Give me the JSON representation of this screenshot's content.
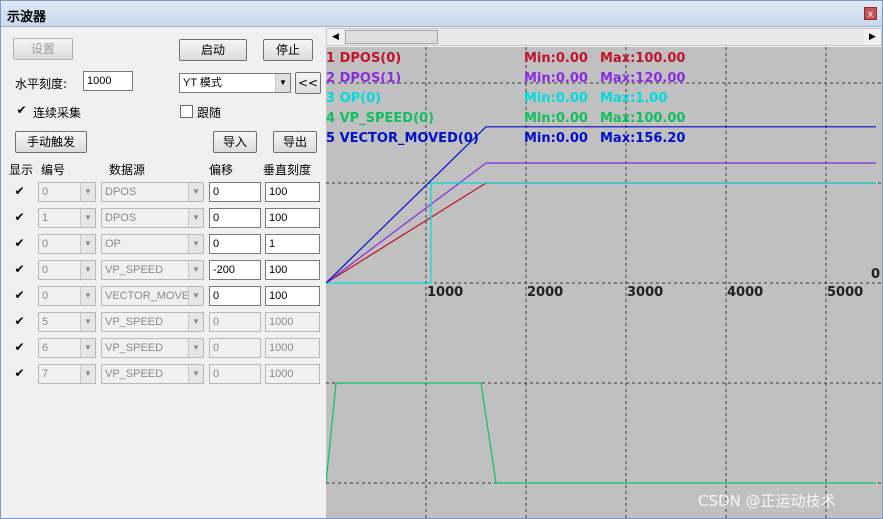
{
  "window": {
    "title": "示波器",
    "close": "x"
  },
  "buttons": {
    "settings": "设置",
    "start": "启动",
    "stop": "停止",
    "collapse": "<<",
    "manual_trigger": "手动触发",
    "import": "导入",
    "export": "导出"
  },
  "labels": {
    "horizontal_scale": "水平刻度:",
    "continuous": "连续采集",
    "follow": "跟随"
  },
  "horizontal_scale_value": "1000",
  "mode": "YT 模式",
  "table": {
    "headers": {
      "show": "显示",
      "num": "编号",
      "source": "数据源",
      "offset": "偏移",
      "vscale": "垂直刻度"
    },
    "rows": [
      {
        "show": "✔",
        "num": "0",
        "source": "DPOS",
        "offset": "0",
        "scale": "100",
        "active": true
      },
      {
        "show": "✔",
        "num": "1",
        "source": "DPOS",
        "offset": "0",
        "scale": "100",
        "active": true
      },
      {
        "show": "✔",
        "num": "0",
        "source": "OP",
        "offset": "0",
        "scale": "1",
        "active": true
      },
      {
        "show": "✔",
        "num": "0",
        "source": "VP_SPEED",
        "offset": "-200",
        "scale": "100",
        "active": true
      },
      {
        "show": "✔",
        "num": "0",
        "source": "VECTOR_MOVED",
        "offset": "0",
        "scale": "100",
        "active": true
      },
      {
        "show": "✔",
        "num": "5",
        "source": "VP_SPEED",
        "offset": "0",
        "scale": "1000",
        "active": false
      },
      {
        "show": "✔",
        "num": "6",
        "source": "VP_SPEED",
        "offset": "0",
        "scale": "1000",
        "active": false
      },
      {
        "show": "✔",
        "num": "7",
        "source": "VP_SPEED",
        "offset": "0",
        "scale": "1000",
        "active": false
      }
    ]
  },
  "scroll": {
    "left": "◀",
    "right": "▶"
  },
  "chart_data": {
    "type": "line",
    "xlim": [
      0,
      5500
    ],
    "x_ticks": [
      "0",
      "1000",
      "2000",
      "3000",
      "4000",
      "5000"
    ],
    "grid": true,
    "legend_position": "top-left",
    "legend": [
      {
        "label": "1 DPOS(0)",
        "min": "Min:0.00",
        "max": "Max:100.00",
        "color": "#c0142c"
      },
      {
        "label": "2 DPOS(1)",
        "min": "Min:0.00",
        "max": "Max:120.00",
        "color": "#8a2be2"
      },
      {
        "label": "3 OP(0)",
        "min": "Min:0.00",
        "max": "Max:1.00",
        "color": "#00dcdc"
      },
      {
        "label": "4 VP_SPEED(0)",
        "min": "Min:0.00",
        "max": "Max:100.00",
        "color": "#10c060"
      },
      {
        "label": "5 VECTOR_MOVED(0)",
        "min": "Min:0.00",
        "max": "Max:156.20",
        "color": "#0010c8"
      }
    ],
    "series": [
      {
        "name": "1 DPOS(0)",
        "color": "#c0142c",
        "x": [
          0,
          1600,
          5500
        ],
        "y": [
          0,
          100,
          100
        ]
      },
      {
        "name": "2 DPOS(1)",
        "color": "#8a2be2",
        "x": [
          0,
          1600,
          5500
        ],
        "y": [
          0,
          120,
          120
        ]
      },
      {
        "name": "3 OP(0)",
        "color": "#00dcdc",
        "x": [
          0,
          1050,
          1050,
          5500
        ],
        "y": [
          0,
          0,
          100,
          100
        ]
      },
      {
        "name": "4 VP_SPEED(0)",
        "color": "#10c060",
        "x": [
          0,
          100,
          1550,
          1700,
          5500
        ],
        "y": [
          -200,
          -100,
          -100,
          -200,
          -200
        ]
      },
      {
        "name": "5 VECTOR_MOVED(0)",
        "color": "#0010c8",
        "x": [
          0,
          1600,
          5500
        ],
        "y": [
          0,
          156.2,
          156.2
        ]
      }
    ]
  },
  "watermark": "CSDN @正运动技术"
}
